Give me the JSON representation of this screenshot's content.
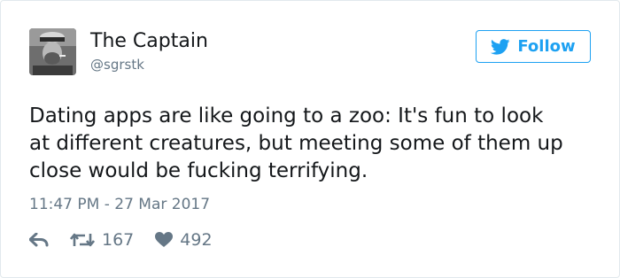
{
  "user": {
    "name": "The Captain",
    "handle": "@sgrstk"
  },
  "follow_button": {
    "label": "Follow",
    "icon": "twitter-bird-icon"
  },
  "tweet": {
    "text": "Dating apps are like going to a zoo: It's fun to look\nat different creatures, but meeting some of them up\nclose would be fucking terrifying.",
    "timestamp": "11:47 PM - 27 Mar 2017"
  },
  "actions": {
    "reply_icon": "reply-icon",
    "retweet_icon": "retweet-icon",
    "retweet_count": "167",
    "like_icon": "heart-icon",
    "like_count": "492"
  },
  "colors": {
    "accent": "#1da1f2",
    "text": "#14171a",
    "muted": "#657786",
    "border": "#e1e8ed"
  }
}
